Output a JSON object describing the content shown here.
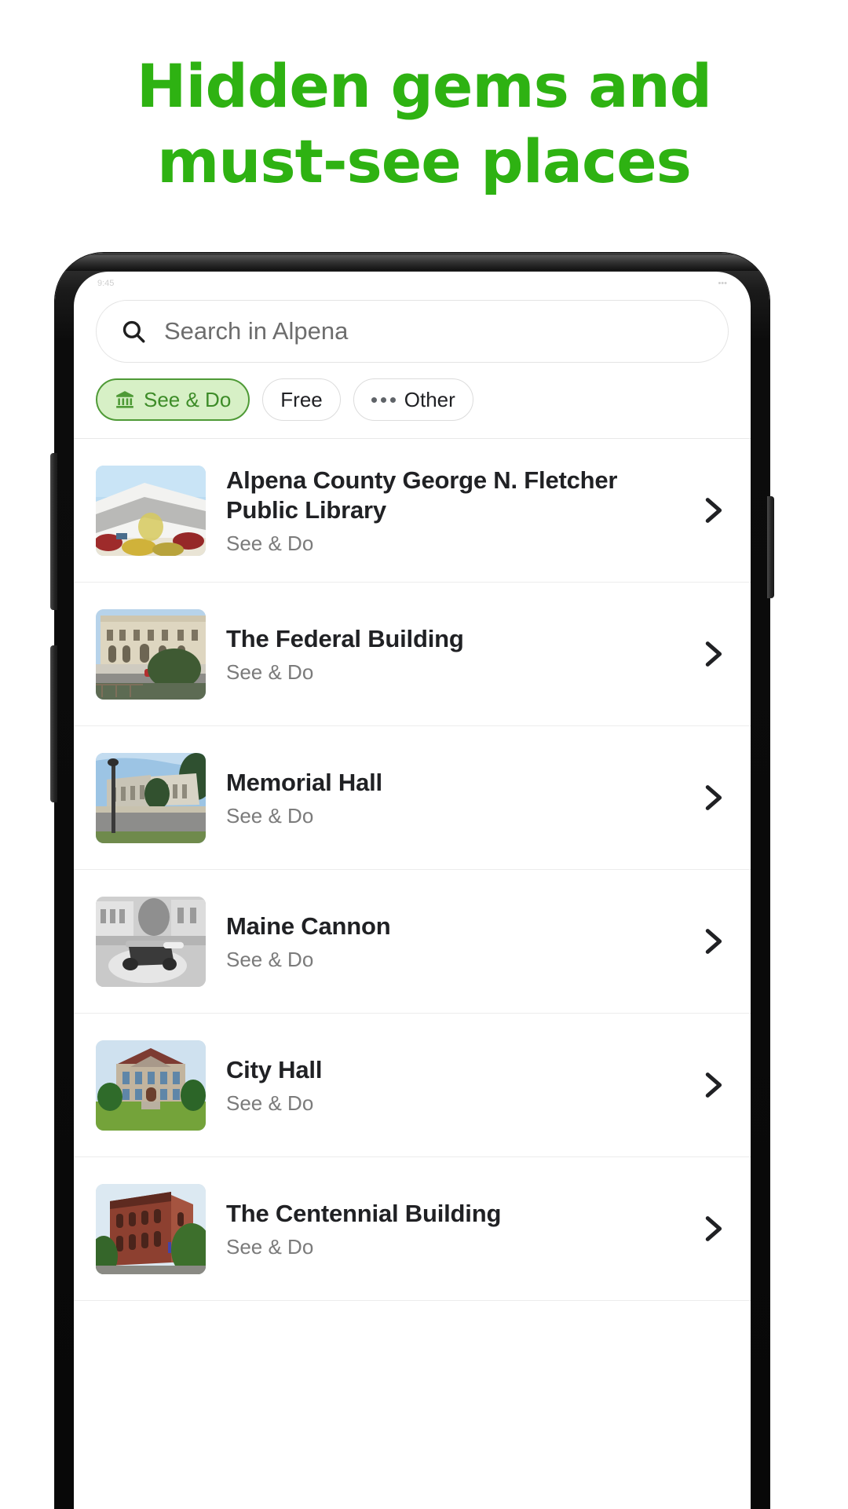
{
  "headline": {
    "line1": "Hidden gems and",
    "line2": "must-see places",
    "color": "#2eb212"
  },
  "status_bar": {
    "left": "9:45",
    "right": "•••"
  },
  "search": {
    "placeholder": "Search in Alpena",
    "icon": "search-icon"
  },
  "filters": {
    "chips": [
      {
        "label": "See & Do",
        "icon": "museum-icon",
        "selected": true
      },
      {
        "label": "Free",
        "icon": "",
        "selected": false
      },
      {
        "label": "Other",
        "icon": "more-horizontal-icon",
        "selected": false
      }
    ],
    "selected_bg": "#d7f0c6",
    "selected_fg": "#3d8c28"
  },
  "list": {
    "items": [
      {
        "title": "Alpena County George N. Fletcher Public Library",
        "subtitle": "See & Do",
        "thumb": "library-photo",
        "chevron": "chevron-right-icon"
      },
      {
        "title": "The Federal Building",
        "subtitle": "See & Do",
        "thumb": "federal-building-photo",
        "chevron": "chevron-right-icon"
      },
      {
        "title": "Memorial Hall",
        "subtitle": "See & Do",
        "thumb": "memorial-hall-photo",
        "chevron": "chevron-right-icon"
      },
      {
        "title": "Maine Cannon",
        "subtitle": "See & Do",
        "thumb": "maine-cannon-photo",
        "chevron": "chevron-right-icon"
      },
      {
        "title": "City Hall",
        "subtitle": "See & Do",
        "thumb": "city-hall-photo",
        "chevron": "chevron-right-icon"
      },
      {
        "title": "The Centennial Building",
        "subtitle": "See & Do",
        "thumb": "centennial-building-photo",
        "chevron": "chevron-right-icon"
      }
    ]
  }
}
